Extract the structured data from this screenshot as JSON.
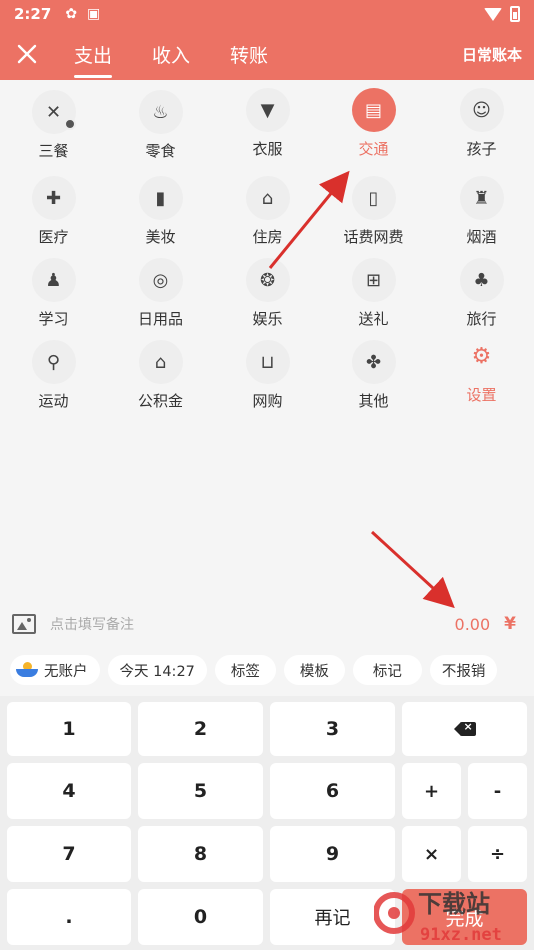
{
  "status_bar": {
    "time": "2:27"
  },
  "header": {
    "tabs": [
      {
        "label": "支出",
        "active": true
      },
      {
        "label": "收入",
        "active": false
      },
      {
        "label": "转账",
        "active": false
      }
    ],
    "book_label": "日常账本"
  },
  "categories": [
    {
      "label": "三餐",
      "icon": "fork-knife-icon"
    },
    {
      "label": "零食",
      "icon": "cupcake-icon"
    },
    {
      "label": "衣服",
      "icon": "shirt-icon"
    },
    {
      "label": "交通",
      "icon": "bus-icon",
      "active": true
    },
    {
      "label": "孩子",
      "icon": "baby-face-icon"
    },
    {
      "label": "医疗",
      "icon": "medicine-icon"
    },
    {
      "label": "美妆",
      "icon": "lipstick-icon"
    },
    {
      "label": "住房",
      "icon": "house-icon"
    },
    {
      "label": "话费网费",
      "icon": "phone-icon"
    },
    {
      "label": "烟酒",
      "icon": "bottle-icon"
    },
    {
      "label": "学习",
      "icon": "student-icon"
    },
    {
      "label": "日用品",
      "icon": "tissue-icon"
    },
    {
      "label": "娱乐",
      "icon": "film-reel-icon"
    },
    {
      "label": "送礼",
      "icon": "gift-icon"
    },
    {
      "label": "旅行",
      "icon": "palm-tree-icon"
    },
    {
      "label": "运动",
      "icon": "bicycle-icon"
    },
    {
      "label": "公积金",
      "icon": "house-fund-icon"
    },
    {
      "label": "网购",
      "icon": "cart-icon"
    },
    {
      "label": "其他",
      "icon": "grid-icon"
    },
    {
      "label": "设置",
      "icon": "gear-icon",
      "settings": true
    }
  ],
  "memo": {
    "placeholder": "点击填写备注",
    "amount": "0.00",
    "currency": "¥"
  },
  "chips": {
    "account": "无账户",
    "date": "今天 14:27",
    "tags": "标签",
    "template": "模板",
    "mark": "标记",
    "reimburse": "不报销"
  },
  "keypad": {
    "k1": "1",
    "k2": "2",
    "k3": "3",
    "k4": "4",
    "k5": "5",
    "k6": "6",
    "plus": "+",
    "minus": "-",
    "k7": "7",
    "k8": "8",
    "k9": "9",
    "times": "×",
    "divide": "÷",
    "dot": ".",
    "k0": "0",
    "again": "再记",
    "done": "完成"
  },
  "watermark": {
    "text": "下载站",
    "domain": "91xz.net"
  },
  "colors": {
    "accent": "#ec7264",
    "arrow": "#d9302c"
  }
}
